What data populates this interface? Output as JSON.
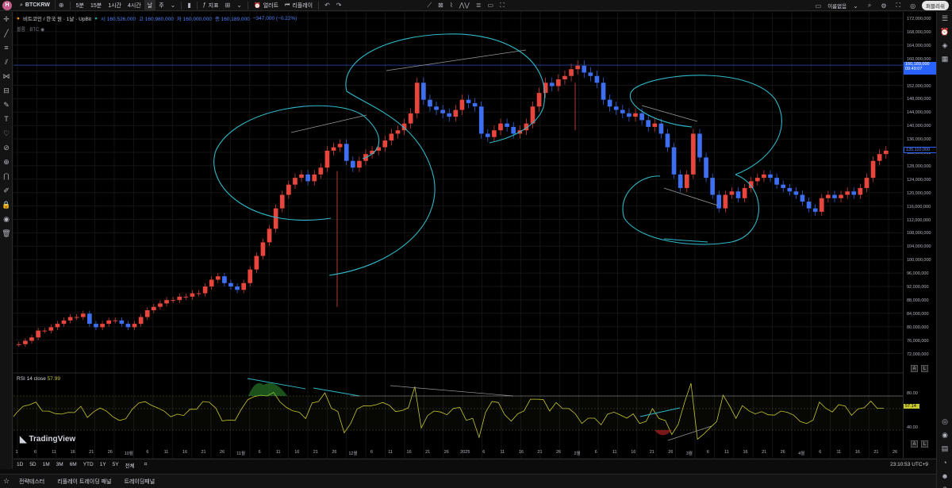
{
  "topbar": {
    "logo": "H",
    "symbol": "BTCKRW",
    "intervals": [
      "5분",
      "15분",
      "1시간",
      "4시간",
      "날",
      "주"
    ],
    "active_interval": "날",
    "indicators_label": "지표",
    "alert_label": "얼러트",
    "replay_label": "리플레이",
    "layout_name": "이름없음",
    "publish_label": "퍼블리쉬"
  },
  "legend": {
    "name": "비트코인 / 한국 원 · 1날 · UpBit",
    "open": "시 160,526,000",
    "high": "고 160,980,000",
    "low": "저 160,000,000",
    "close": "종 160,189,000",
    "change": "−347,000 (−0.22%)",
    "volume": "볼륨 · BTC"
  },
  "rsi_legend": {
    "label": "RSI 14 close",
    "value": "57.99"
  },
  "tv_logo": "TradingView",
  "price_scale": {
    "labels": [
      "172,000,000",
      "168,000,000",
      "164,000,000",
      "160,000,000",
      "156,000,000",
      "152,000,000",
      "148,000,000",
      "144,000,000",
      "140,000,000",
      "136,000,000",
      "132,000,000",
      "128,000,000",
      "124,000,000",
      "120,000,000",
      "116,000,000",
      "112,000,000",
      "108,000,000",
      "104,000,000",
      "100,000,000",
      "96,000,000",
      "92,000,000",
      "88,000,000",
      "84,000,000",
      "80,000,000",
      "76,000,000",
      "72,000,000"
    ],
    "current_price": "160,189,000",
    "countdown": "09:49:07",
    "last_price": "135,110,000",
    "rsi_labels": [
      "80.00",
      "60.00",
      "40.00"
    ],
    "rsi_current": "57.14",
    "a_label": "A",
    "l_label": "L"
  },
  "time_axis": [
    "1",
    "6",
    "11",
    "16",
    "21",
    "26",
    "10월",
    "6",
    "11",
    "16",
    "21",
    "26",
    "11월",
    "6",
    "11",
    "16",
    "21",
    "26",
    "12월",
    "6",
    "11",
    "16",
    "21",
    "26",
    "2025",
    "6",
    "11",
    "16",
    "21",
    "26",
    "2월",
    "6",
    "11",
    "16",
    "21",
    "26",
    "3월",
    "6",
    "11",
    "16",
    "21",
    "26",
    "4월",
    "6",
    "11",
    "16",
    "21",
    "26"
  ],
  "range_bar": {
    "ranges": [
      "1D",
      "5D",
      "1M",
      "3M",
      "6M",
      "YTD",
      "1Y",
      "5Y",
      "전체"
    ],
    "clock": "23:10:53 UTC+9"
  },
  "bottom_tabs": [
    "전략테스터",
    "리플레이 트레이딩 패널",
    "트레이딩패널"
  ],
  "colors": {
    "up": "#e8453c",
    "down": "#3d6ff0",
    "annotation": "#2fb8c8",
    "rsi": "#c8c830",
    "trend": "#9a9a9a"
  },
  "chart_data": {
    "type": "candlestick",
    "price_axis_range": [
      70000000,
      174000000
    ],
    "closes_approx": [
      78,
      79,
      80,
      82,
      82,
      83,
      84,
      85,
      86,
      86,
      87,
      84,
      83,
      84,
      85,
      85,
      84,
      83,
      84,
      86,
      88,
      89,
      90,
      91,
      91,
      92,
      92,
      93,
      93,
      95,
      97,
      98,
      96,
      95,
      94,
      96,
      100,
      104,
      108,
      112,
      118,
      122,
      125,
      127,
      128,
      126,
      128,
      130,
      135,
      136,
      137,
      132,
      130,
      132,
      134,
      135,
      136,
      138,
      140,
      141,
      143,
      146,
      155,
      150,
      148,
      147,
      146,
      145,
      147,
      150,
      149,
      148,
      140,
      139,
      141,
      143,
      142,
      140,
      141,
      143,
      148,
      152,
      155,
      154,
      156,
      157,
      159,
      160,
      158,
      157,
      155,
      150,
      148,
      147,
      146,
      145,
      146,
      144,
      142,
      143,
      140,
      136,
      128,
      124,
      128,
      140,
      133,
      127,
      122,
      118,
      122,
      123,
      121,
      124,
      126,
      127,
      128,
      127,
      125,
      124,
      123,
      122,
      120,
      118,
      117,
      121,
      122,
      121,
      122,
      123,
      122,
      124,
      127,
      132,
      134,
      135
    ]
  }
}
